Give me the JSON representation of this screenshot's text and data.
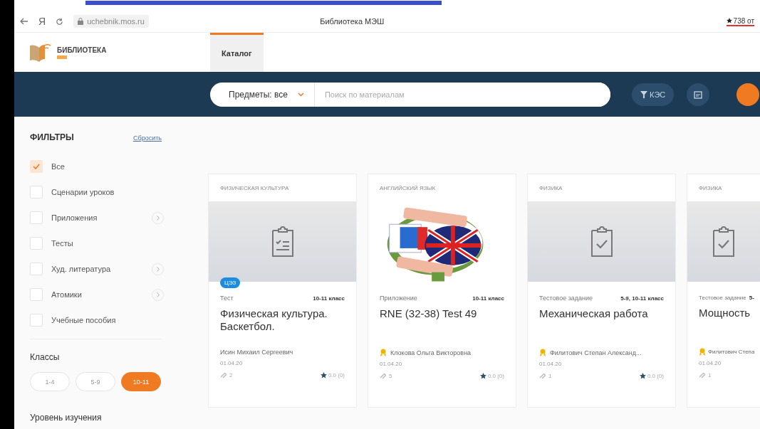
{
  "browser": {
    "address": "uchebnik.mos.ru",
    "page_title": "Библиотека МЭШ",
    "browser_letter": "Я",
    "rating": "738 от"
  },
  "header": {
    "logo_text": "БИБЛИОТЕКА",
    "tabs": [
      {
        "label": "Каталог",
        "selected": true
      }
    ]
  },
  "navbar": {
    "subject_select": "Предметы: все",
    "search": {
      "placeholder": "Поиск по материалам"
    },
    "kes_button": "КЭС"
  },
  "filters": {
    "title": "ФИЛЬТРЫ",
    "reset": "Сбросить",
    "items": [
      {
        "label": "Все",
        "checked": true,
        "has_submenu": false
      },
      {
        "label": "Сценарии уроков",
        "checked": false,
        "has_submenu": false
      },
      {
        "label": "Приложения",
        "checked": false,
        "has_submenu": true
      },
      {
        "label": "Тесты",
        "checked": false,
        "has_submenu": false
      },
      {
        "label": "Худ. литература",
        "checked": false,
        "has_submenu": true
      },
      {
        "label": "Атомики",
        "checked": false,
        "has_submenu": true
      },
      {
        "label": "Учебные пособия",
        "checked": false,
        "has_submenu": false
      }
    ],
    "classes_title": "Классы",
    "classes": [
      {
        "label": "1-4",
        "selected": false
      },
      {
        "label": "5-9",
        "selected": false
      },
      {
        "label": "10-11",
        "selected": true
      }
    ],
    "level_title": "Уровень изучения"
  },
  "cards": [
    {
      "subject": "ФИЗИЧЕСКАЯ КУЛЬТУРА",
      "kind": "test-list",
      "badge": "ЦЭЗ",
      "type": "Тест",
      "grade": "10-11 класс",
      "title": "Физическая культура. Баскетбол.",
      "author": "Исин Михаил Сергеевич",
      "author_award": false,
      "date": "01.04.20",
      "count": "2",
      "rating": "0.0 (0)"
    },
    {
      "subject": "АНГЛИЙСКИЙ ЯЗЫК",
      "kind": "picture",
      "type": "Приложение",
      "grade": "10-11 класс",
      "title": "RNE (32-38) Test 49",
      "author": "Клокова Ольга Викторовна",
      "author_award": true,
      "date": "01.04.20",
      "count": "5",
      "rating": "0.0 (0)"
    },
    {
      "subject": "ФИЗИКА",
      "kind": "test-check",
      "type": "Тестовое задание",
      "grade": "5-9, 10-11 класс",
      "title": "Механическая работа",
      "author": "Филитович Степан Александ...",
      "author_award": true,
      "date": "01.04.20",
      "count": "1",
      "rating": "0.0 (0)"
    },
    {
      "subject": "ФИЗИКА",
      "kind": "test-check",
      "type": "Тестовое задание",
      "grade": "5-",
      "title": "Мощность",
      "author": "Филитович Степа",
      "author_award": true,
      "date": "01.04.20",
      "count": "1"
    }
  ]
}
